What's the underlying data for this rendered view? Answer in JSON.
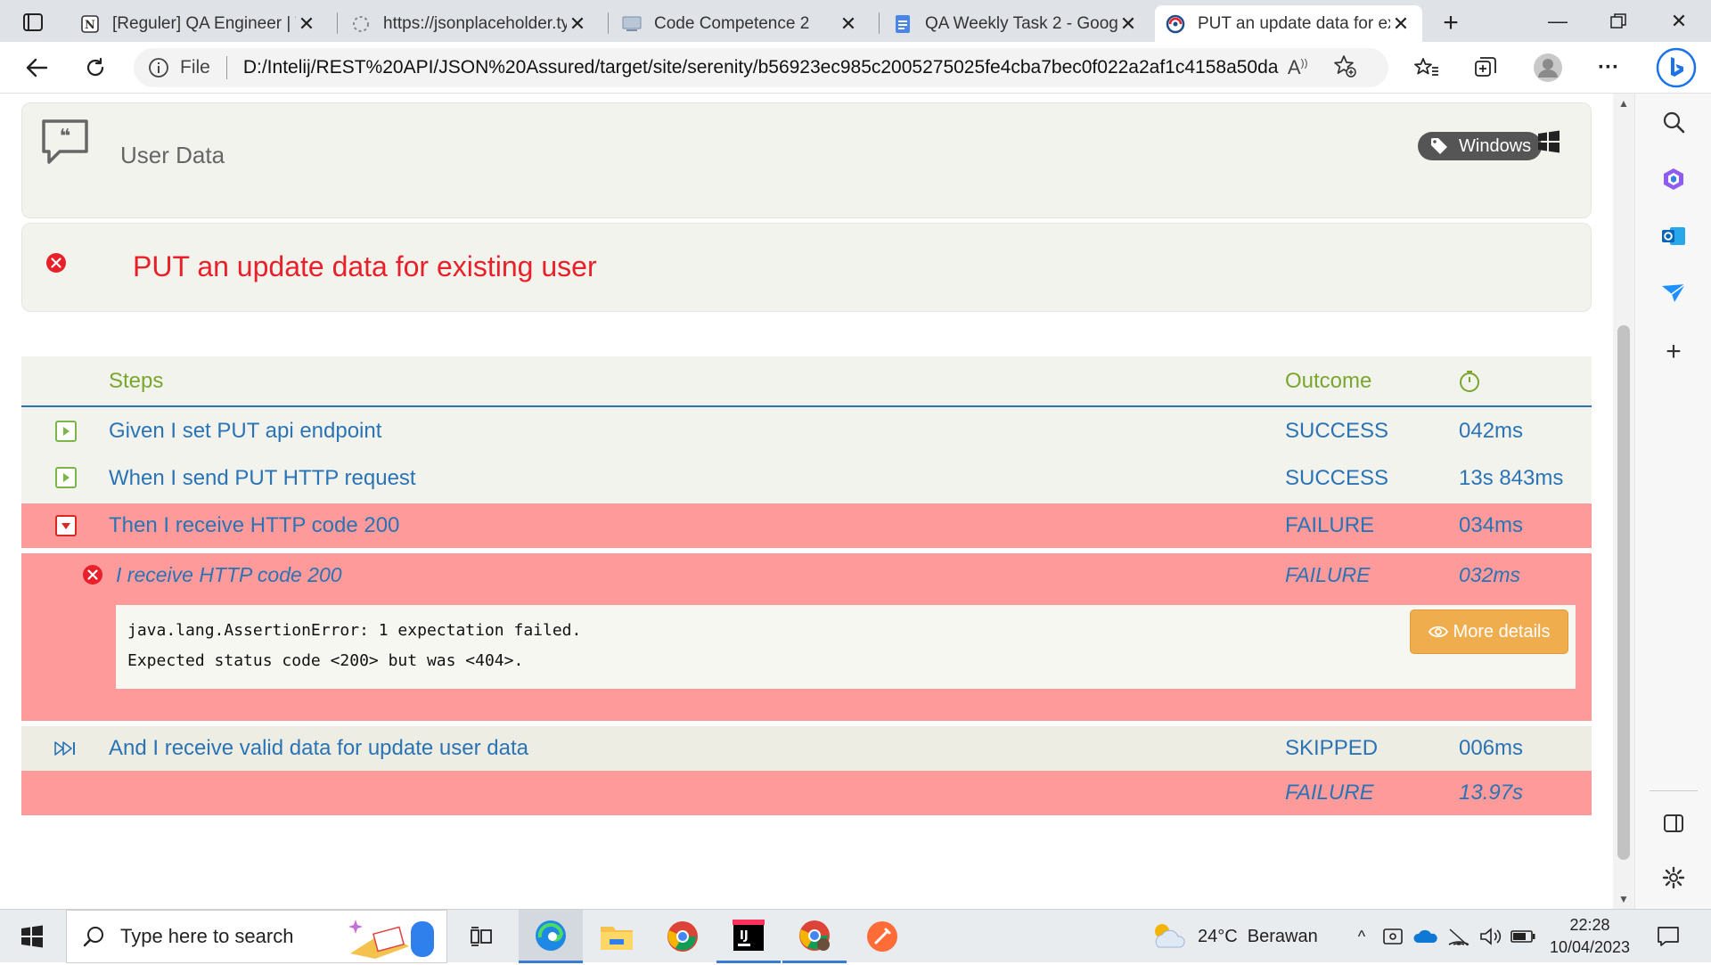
{
  "tabs": [
    {
      "title": "[Reguler] QA Engineer | Ti",
      "icon": "notion-icon"
    },
    {
      "title": "https://jsonplaceholder.typ",
      "icon": "loading-icon"
    },
    {
      "title": "Code Competence 2",
      "icon": "page-icon"
    },
    {
      "title": "QA Weekly Task 2 - Googl",
      "icon": "google-docs-icon"
    },
    {
      "title": "PUT an update data for ex",
      "icon": "serenity-icon",
      "active": true
    }
  ],
  "address": {
    "scheme_label": "File",
    "url": "D:/Intelij/REST%20API/JSON%20Assured/target/site/serenity/b56923ec985c2005275025fe4cba7bec0f022a2af1c4158a50da1..."
  },
  "report": {
    "story_title": "User Data",
    "tag": "Windows",
    "scenario_title": "PUT an update data for existing user",
    "headers": {
      "steps": "Steps",
      "outcome": "Outcome"
    },
    "steps": [
      {
        "text": "Given I set PUT api endpoint",
        "outcome": "SUCCESS",
        "duration": "042ms"
      },
      {
        "text": "When I send PUT HTTP request",
        "outcome": "SUCCESS",
        "duration": "13s 843ms"
      },
      {
        "text": "Then I receive HTTP code 200",
        "outcome": "FAILURE",
        "duration": "034ms"
      },
      {
        "text": "And I receive valid data for update user data",
        "outcome": "SKIPPED",
        "duration": "006ms"
      }
    ],
    "substep": {
      "text": "I receive HTTP code 200",
      "outcome": "FAILURE",
      "duration": "032ms"
    },
    "error": {
      "line1": "java.lang.AssertionError: 1 expectation failed.",
      "line2": "Expected status code <200> but was <404>.",
      "button": "More details"
    },
    "total": {
      "outcome": "FAILURE",
      "duration": "13.97s"
    }
  },
  "colors": {
    "failure_bg": "#ff9a9a",
    "link_blue": "#2a74b5",
    "header_green": "#7aa62e",
    "fail_red": "#e8202a",
    "more_details": "#f0ad4e"
  },
  "taskbar": {
    "search_placeholder": "Type here to search",
    "weather": "24°C  Berawan",
    "time": "22:28",
    "date": "10/04/2023"
  }
}
